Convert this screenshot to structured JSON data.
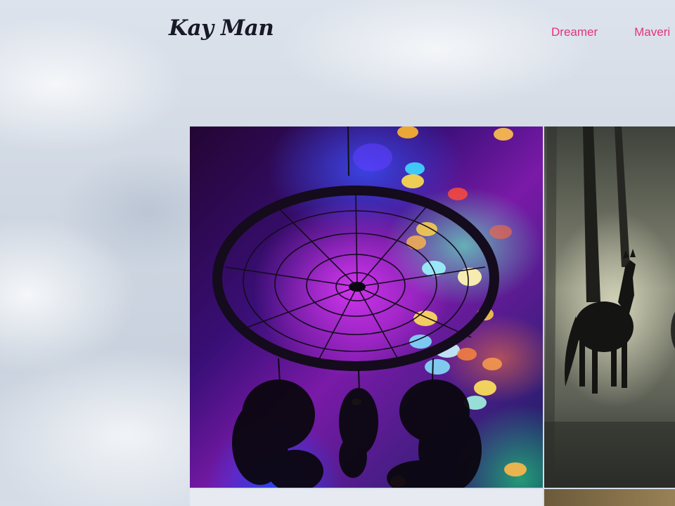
{
  "site": {
    "logo": "Kay Man"
  },
  "nav": {
    "items": [
      {
        "label": "Dreamer"
      },
      {
        "label": "Maveri"
      }
    ]
  },
  "gallery": {
    "items": [
      {
        "subject": "dreamcatcher-image"
      },
      {
        "subject": "horses-in-mist-image"
      }
    ]
  },
  "colors": {
    "nav_link": "#e3337d",
    "logo": "#181828"
  }
}
